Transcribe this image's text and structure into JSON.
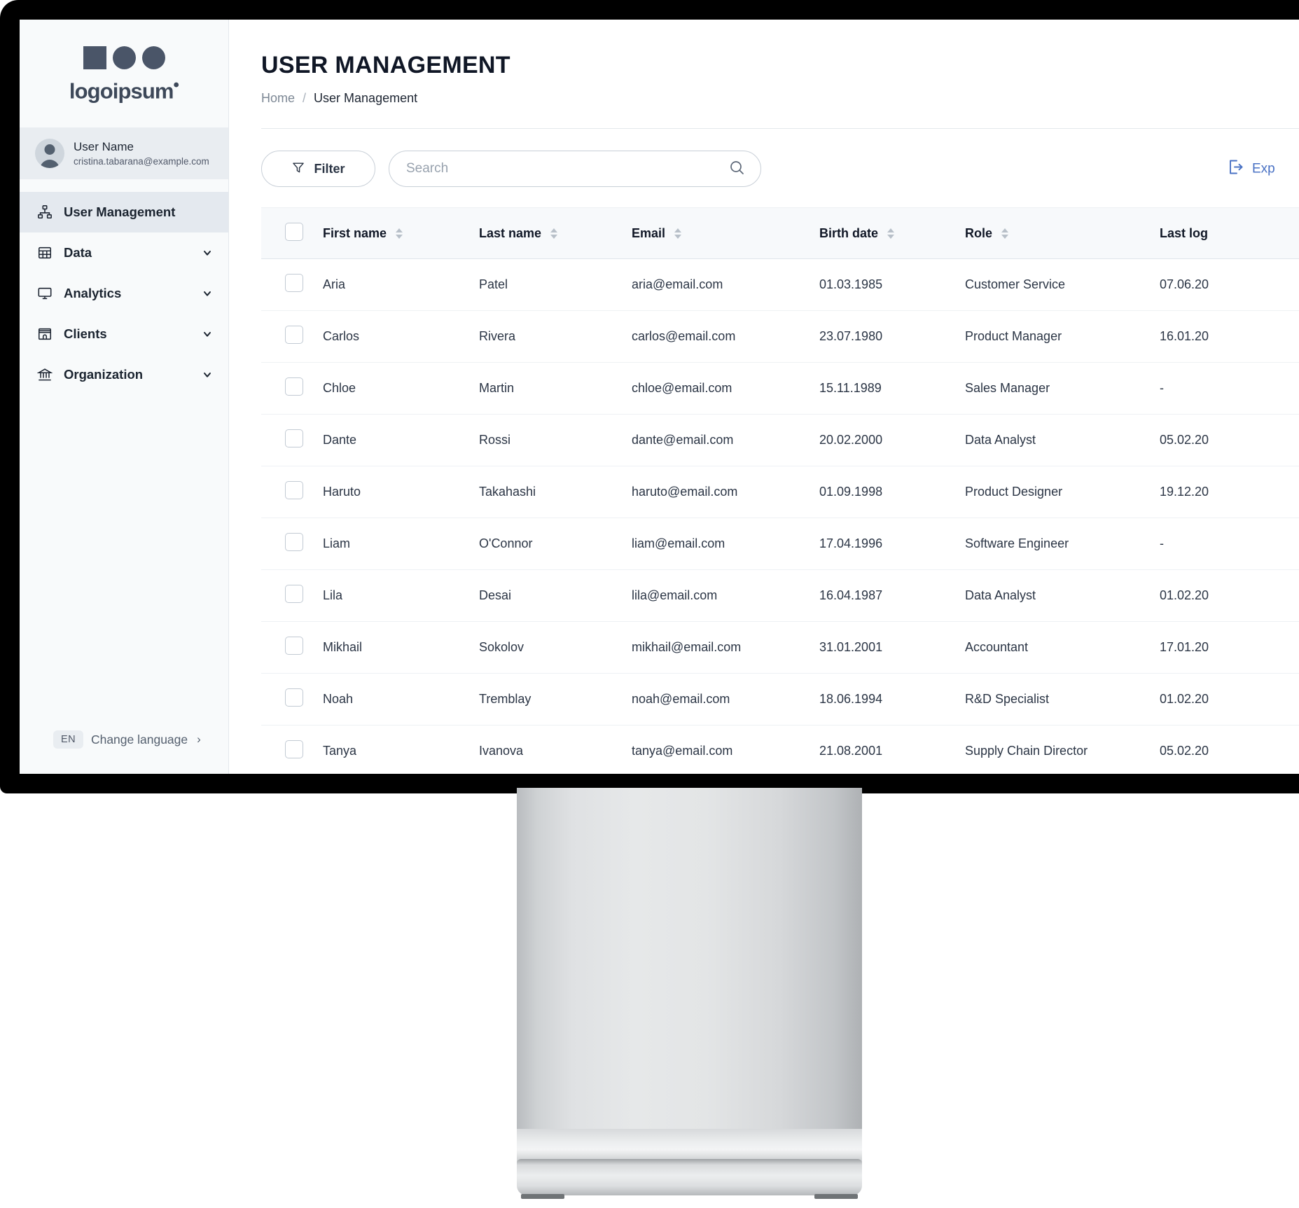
{
  "brand": {
    "name": "logoipsum",
    "dot": "•"
  },
  "user": {
    "name": "User Name",
    "email": "cristina.tabarana@example.com"
  },
  "sidebar": {
    "items": [
      {
        "label": "User Management",
        "icon": "sitemap-icon",
        "active": true,
        "expandable": false
      },
      {
        "label": "Data",
        "icon": "table-icon",
        "active": false,
        "expandable": true
      },
      {
        "label": "Analytics",
        "icon": "monitor-icon",
        "active": false,
        "expandable": true
      },
      {
        "label": "Clients",
        "icon": "store-icon",
        "active": false,
        "expandable": true
      },
      {
        "label": "Organization",
        "icon": "bank-icon",
        "active": false,
        "expandable": true
      }
    ],
    "language": {
      "code": "EN",
      "label": "Change language",
      "arrow": "›"
    }
  },
  "header": {
    "title": "USER MANAGEMENT",
    "breadcrumb": {
      "home": "Home",
      "separator": "/",
      "current": "User Management"
    }
  },
  "toolbar": {
    "filter_label": "Filter",
    "search_placeholder": "Search",
    "search_value": "",
    "export_label": "Exp",
    "accent_color": "#4a72c4"
  },
  "table": {
    "columns": [
      {
        "key": "checkbox",
        "label": "",
        "sortable": false
      },
      {
        "key": "first_name",
        "label": "First name",
        "sortable": true
      },
      {
        "key": "last_name",
        "label": "Last name",
        "sortable": true
      },
      {
        "key": "email",
        "label": "Email",
        "sortable": true
      },
      {
        "key": "birth_date",
        "label": "Birth date",
        "sortable": true
      },
      {
        "key": "role",
        "label": "Role",
        "sortable": true
      },
      {
        "key": "last_login",
        "label": "Last log",
        "sortable": false
      }
    ],
    "rows": [
      {
        "first_name": "Aria",
        "last_name": "Patel",
        "email": "aria@email.com",
        "birth_date": "01.03.1985",
        "role": "Customer Service",
        "last_login": "07.06.20"
      },
      {
        "first_name": "Carlos",
        "last_name": "Rivera",
        "email": "carlos@email.com",
        "birth_date": "23.07.1980",
        "role": "Product Manager",
        "last_login": "16.01.20"
      },
      {
        "first_name": "Chloe",
        "last_name": "Martin",
        "email": "chloe@email.com",
        "birth_date": "15.11.1989",
        "role": "Sales Manager",
        "last_login": "-"
      },
      {
        "first_name": "Dante",
        "last_name": "Rossi",
        "email": "dante@email.com",
        "birth_date": "20.02.2000",
        "role": "Data Analyst",
        "last_login": "05.02.20"
      },
      {
        "first_name": "Haruto",
        "last_name": "Takahashi",
        "email": "haruto@email.com",
        "birth_date": "01.09.1998",
        "role": "Product Designer",
        "last_login": "19.12.20"
      },
      {
        "first_name": "Liam",
        "last_name": "O'Connor",
        "email": "liam@email.com",
        "birth_date": "17.04.1996",
        "role": "Software Engineer",
        "last_login": "-"
      },
      {
        "first_name": "Lila",
        "last_name": "Desai",
        "email": "lila@email.com",
        "birth_date": "16.04.1987",
        "role": "Data Analyst",
        "last_login": "01.02.20"
      },
      {
        "first_name": "Mikhail",
        "last_name": "Sokolov",
        "email": "mikhail@email.com",
        "birth_date": "31.01.2001",
        "role": "Accountant",
        "last_login": "17.01.20"
      },
      {
        "first_name": "Noah",
        "last_name": "Tremblay",
        "email": "noah@email.com",
        "birth_date": "18.06.1994",
        "role": "R&D Specialist",
        "last_login": "01.02.20"
      },
      {
        "first_name": "Tanya",
        "last_name": "Ivanova",
        "email": "tanya@email.com",
        "birth_date": "21.08.2001",
        "role": "Supply Chain Director",
        "last_login": "05.02.20"
      }
    ]
  }
}
